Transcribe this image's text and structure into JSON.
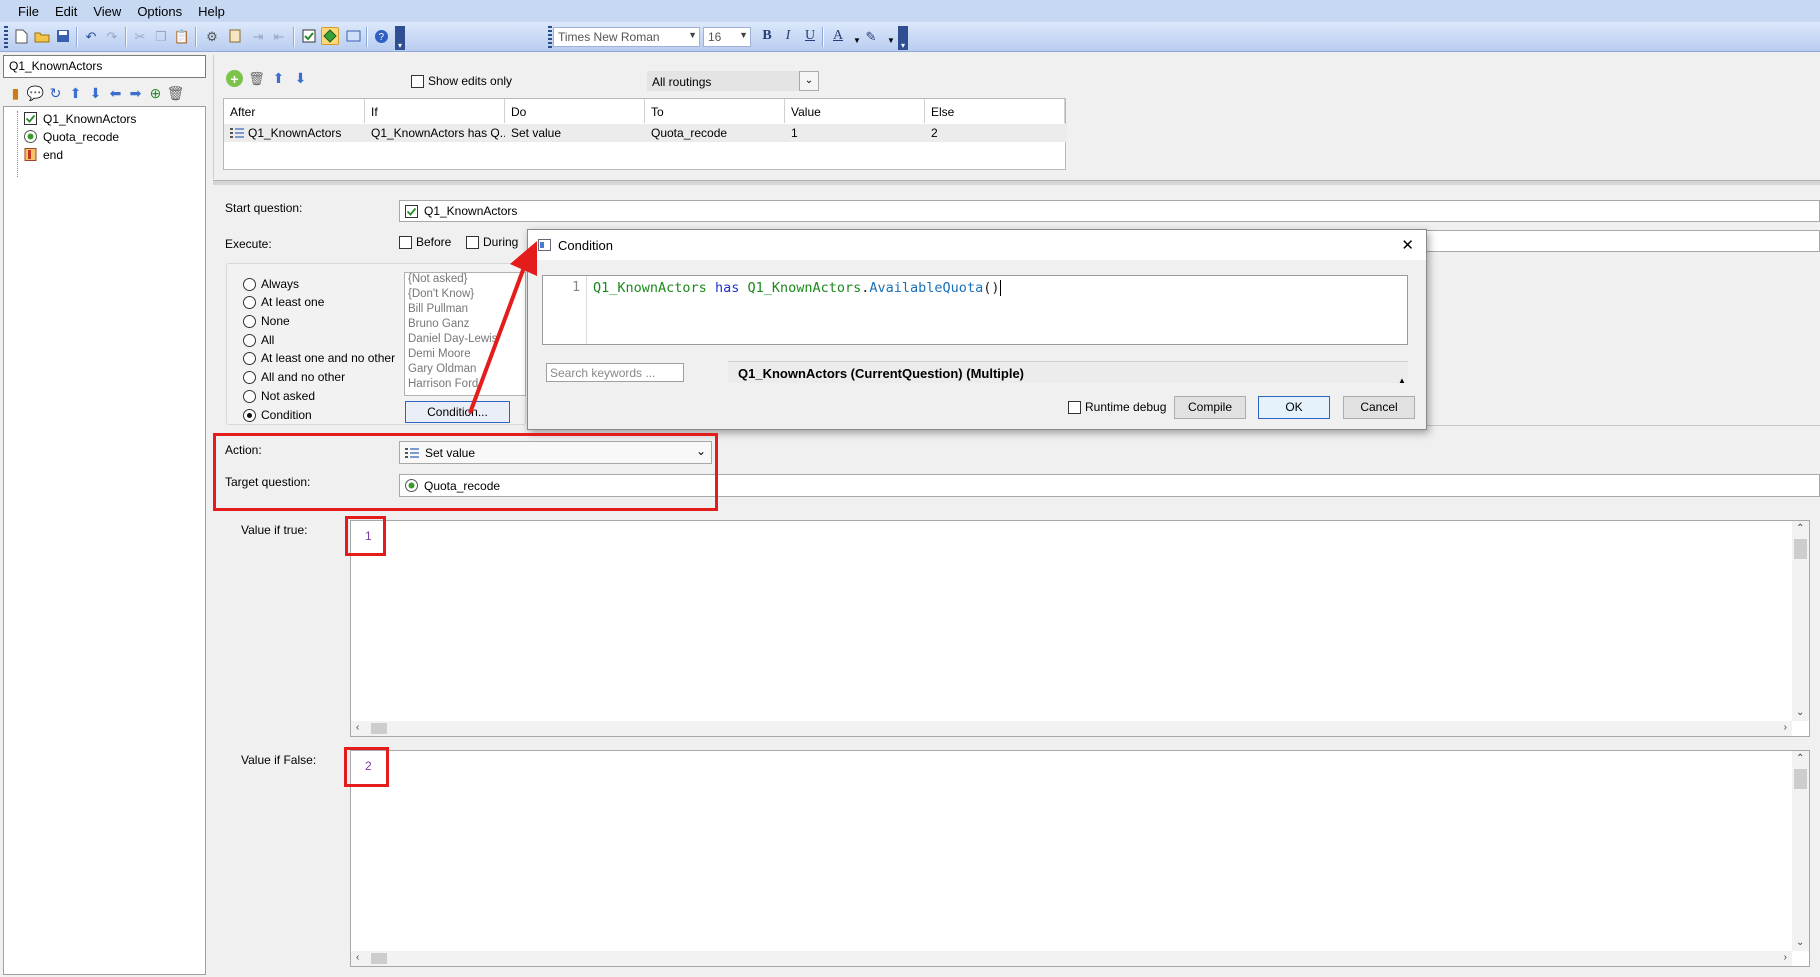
{
  "menu": [
    "File",
    "Edit",
    "View",
    "Options",
    "Help"
  ],
  "toolbar": {
    "font_name": "Times New Roman",
    "font_size": "16",
    "bold": "B",
    "italic": "I",
    "underline": "U",
    "font_color": "A"
  },
  "left": {
    "search_value": "Q1_KnownActors",
    "tree": [
      "Q1_KnownActors",
      "Quota_recode",
      "end"
    ]
  },
  "routing": {
    "show_edits_label": "Show edits only",
    "routes_filter": "All routings",
    "columns": [
      "After",
      "If",
      "Do",
      "To",
      "Value",
      "Else"
    ],
    "rows": [
      [
        "Q1_KnownActors",
        "Q1_KnownActors has Q...",
        "Set value",
        "Quota_recode",
        "1",
        "2"
      ]
    ]
  },
  "form": {
    "start_label": "Start question:",
    "start_value": "Q1_KnownActors",
    "execute_label": "Execute:",
    "before_label": "Before",
    "during_label": "During",
    "conditions": [
      "Always",
      "At least one",
      "None",
      "All",
      "At least one and no other",
      "All and no other",
      "Not asked",
      "Condition"
    ],
    "selected_condition": "Condition",
    "answers": [
      "{Not asked}",
      "{Don't Know}",
      "Bill Pullman",
      "Bruno Ganz",
      "Daniel Day-Lewis",
      "Demi Moore",
      "Gary Oldman",
      "Harrison Ford"
    ],
    "condition_button": "Condition...",
    "action_label": "Action:",
    "action_value": "Set value",
    "target_label": "Target question:",
    "target_value": "Quota_recode",
    "true_label": "Value if true:",
    "true_value": "1",
    "false_label": "Value if False:",
    "false_value": "2"
  },
  "dialog": {
    "title": "Condition",
    "close": "✕",
    "line_number": "1",
    "code": {
      "ident": "Q1_KnownActors",
      "keyword": "has",
      "object": "Q1_KnownActors",
      "method": "AvailableQuota",
      "parens": "()"
    },
    "search_placeholder": "Search keywords ...",
    "info_text": "Q1_KnownActors (CurrentQuestion) (Multiple)",
    "runtime_debug_label": "Runtime debug",
    "compile_label": "Compile",
    "ok_label": "OK",
    "cancel_label": "Cancel"
  },
  "colors": {
    "annotation_red": "#e41c1c",
    "code_identifier": "#1b8a1b",
    "code_keyword": "#1e34c8",
    "value_text": "#7a3aa0"
  }
}
